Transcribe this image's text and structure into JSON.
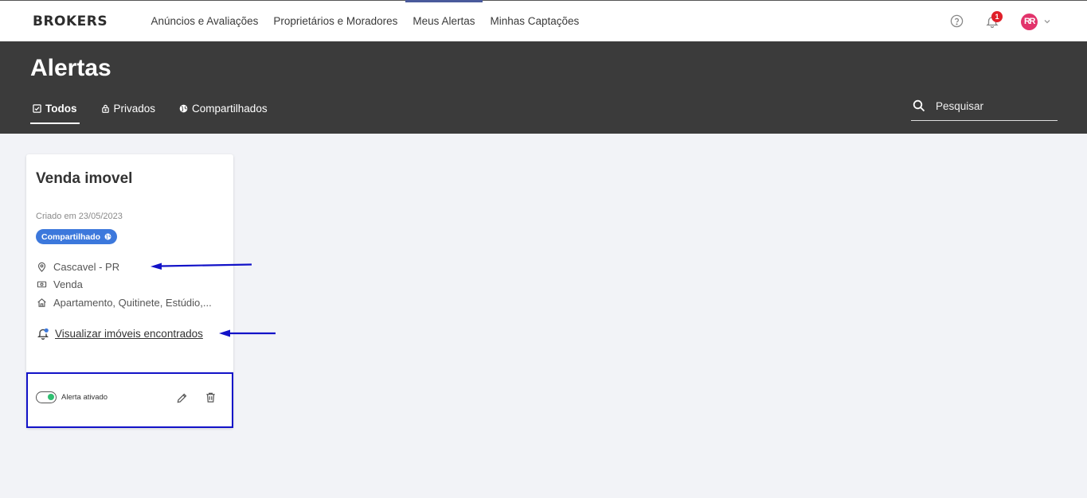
{
  "brand": {
    "logo_text": "BROKERS"
  },
  "nav": {
    "items": [
      {
        "label": "Anúncios e Avaliações"
      },
      {
        "label": "Proprietários e Moradores"
      },
      {
        "label": "Meus Alertas"
      },
      {
        "label": "Minhas Captações"
      }
    ],
    "active": "Meus Alertas"
  },
  "topbar": {
    "notification_count": "1",
    "avatar_initials": "RR"
  },
  "header": {
    "title": "Alertas",
    "tabs": [
      {
        "label": "Todos",
        "icon": "checkbox-icon"
      },
      {
        "label": "Privados",
        "icon": "lock-icon"
      },
      {
        "label": "Compartilhados",
        "icon": "globe-icon"
      }
    ],
    "search": {
      "placeholder": "Pesquisar"
    }
  },
  "card": {
    "title": "Venda imovel",
    "created": "Criado em 23/05/2023",
    "badge": "Compartilhado",
    "location": "Cascavel - PR",
    "transaction": "Venda",
    "property_types": "Apartamento, Quitinete, Estúdio,...",
    "link": "Visualizar imóveis encontrados",
    "toggle_label": "Alerta ativado",
    "toggle_on": true
  },
  "colors": {
    "header_bg": "#3b3b3b",
    "page_bg": "#f2f3f7",
    "badge": "#3c78dc",
    "toggle_on": "#2fbf71",
    "annotation": "#1212c8",
    "notification": "#e0202a",
    "avatar": "#e2336b"
  }
}
